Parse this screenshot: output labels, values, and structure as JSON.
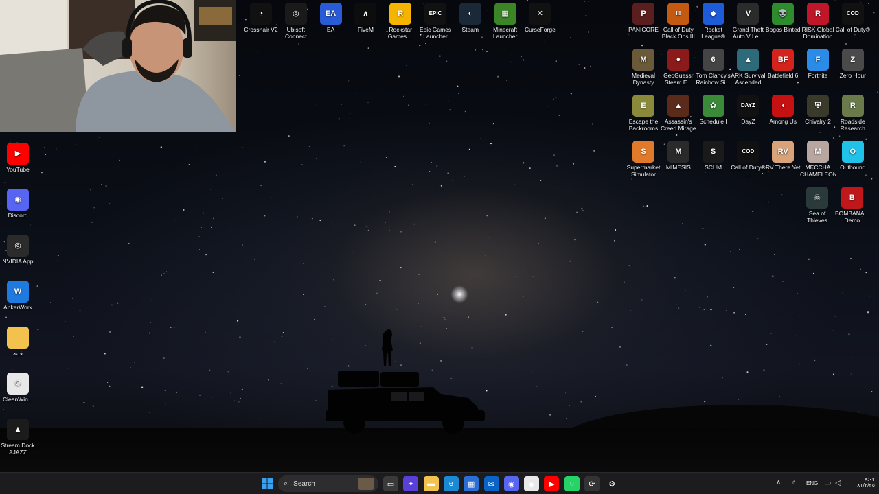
{
  "colors": {
    "accent": "#0a74da",
    "taskbar_bg": "#1c1c1e",
    "sky_top": "#06080d",
    "ground": "#050506"
  },
  "wallpaper": {
    "scene": "night-sky-milky-way-person-on-jeep"
  },
  "webcam_overlay": {
    "subject": "streamer-with-headphones"
  },
  "left_icons": [
    {
      "label": "YouTube",
      "icon": "youtube-icon",
      "color": "#ff0000",
      "glyph": "▶"
    },
    {
      "label": "Discord",
      "icon": "discord-icon",
      "color": "#5865f2",
      "glyph": "◉"
    },
    {
      "label": "NVIDIA App",
      "icon": "nvidia-icon",
      "color": "#2b2b2b",
      "glyph": "◎"
    },
    {
      "label": "AnkerWork",
      "icon": "ankerwork-icon",
      "color": "#1f7ae0",
      "glyph": "W"
    },
    {
      "label": "فلته",
      "icon": "folder-icon",
      "color": "#f2c14e",
      "glyph": ""
    },
    {
      "label": "CleanWin...",
      "icon": "cleanwin-icon",
      "color": "#e8e8e8",
      "glyph": "⚙"
    },
    {
      "label": "Stream Dock AJAZZ",
      "icon": "stream-dock-icon",
      "color": "#1b1b1b",
      "glyph": "▲"
    }
  ],
  "top_icons": [
    {
      "label": "Crosshair V2",
      "icon": "crosshair-icon",
      "color": "#111",
      "glyph": "◔"
    },
    {
      "label": "Ubisoft Connect",
      "icon": "ubisoft-icon",
      "color": "#1a1a1a",
      "glyph": "◎"
    },
    {
      "label": "EA",
      "icon": "ea-icon",
      "color": "#2a5bd7",
      "glyph": "EA"
    },
    {
      "label": "FiveM",
      "icon": "fivem-icon",
      "color": "#0d0d0d",
      "glyph": "∧"
    },
    {
      "label": "Rockstar Games ...",
      "icon": "rockstar-icon",
      "color": "#f4b400",
      "glyph": "R"
    },
    {
      "label": "Epic Games Launcher",
      "icon": "epic-games-icon",
      "color": "#111",
      "glyph": "EPIC"
    },
    {
      "label": "Steam",
      "icon": "steam-icon",
      "color": "#1b2838",
      "glyph": "◐"
    },
    {
      "label": "Minecraft Launcher",
      "icon": "minecraft-icon",
      "color": "#3c8527",
      "glyph": "▦"
    },
    {
      "label": "CurseForge",
      "icon": "curseforge-icon",
      "color": "#111",
      "glyph": "✕"
    }
  ],
  "right_icons": [
    {
      "label": "PANICORE",
      "icon": "panicore-icon",
      "color": "#5a1e1e",
      "glyph": "P"
    },
    {
      "label": "Call of Duty Black Ops III",
      "icon": "cod-bo3-icon",
      "color": "#c45a12",
      "glyph": "III"
    },
    {
      "label": "Rocket League®",
      "icon": "rocket-league-icon",
      "color": "#1e5bd8",
      "glyph": "◆"
    },
    {
      "label": "Grand Theft Auto V Le...",
      "icon": "gta5-icon",
      "color": "#2b2b2b",
      "glyph": "V"
    },
    {
      "label": "Bogos Binted",
      "icon": "alien-icon",
      "color": "#2e8b2e",
      "glyph": "👽"
    },
    {
      "label": "RISK Global Domination",
      "icon": "risk-icon",
      "color": "#c0162a",
      "glyph": "R"
    },
    {
      "label": "Call of Duty®",
      "icon": "call-of-duty-icon",
      "color": "#111",
      "glyph": "COD"
    },
    {
      "label": "Medieval Dynasty",
      "icon": "medieval-dynasty-icon",
      "color": "#6b5a3a",
      "glyph": "M"
    },
    {
      "label": "GeoGuessr Steam E...",
      "icon": "geoguessr-icon",
      "color": "#8b1a1a",
      "glyph": "●"
    },
    {
      "label": "Tom Clancy's Rainbow Si...",
      "icon": "rainbow-six-icon",
      "color": "#444",
      "glyph": "6"
    },
    {
      "label": "ARK Survival Ascended",
      "icon": "ark-icon",
      "color": "#2d6b7a",
      "glyph": "▲"
    },
    {
      "label": "Battlefield 6",
      "icon": "battlefield-icon",
      "color": "#d4221c",
      "glyph": "BF"
    },
    {
      "label": "Fortnite",
      "icon": "fortnite-icon",
      "color": "#2a8ce8",
      "glyph": "F"
    },
    {
      "label": "Zero Hour",
      "icon": "zero-hour-icon",
      "color": "#4a4a4a",
      "glyph": "Z"
    },
    {
      "label": "Escape the Backrooms",
      "icon": "escape-backrooms-icon",
      "color": "#8a8a3a",
      "glyph": "E"
    },
    {
      "label": "Assassin's Creed Mirage",
      "icon": "assassins-creed-icon",
      "color": "#5a2a1a",
      "glyph": "▲"
    },
    {
      "label": "Schedule I",
      "icon": "schedule-one-icon",
      "color": "#3a8a3a",
      "glyph": "✿"
    },
    {
      "label": "DayZ",
      "icon": "dayz-icon",
      "color": "#111",
      "glyph": "DAYZ"
    },
    {
      "label": "Among Us",
      "icon": "among-us-icon",
      "color": "#c51111",
      "glyph": "◖"
    },
    {
      "label": "Chivalry 2",
      "icon": "chivalry-icon",
      "color": "#3a3a2a",
      "glyph": "⛨"
    },
    {
      "label": "Roadside Research",
      "icon": "roadside-research-icon",
      "color": "#6a7a4a",
      "glyph": "R"
    },
    {
      "label": "Supermarket Simulator",
      "icon": "supermarket-icon",
      "color": "#e07a2a",
      "glyph": "S"
    },
    {
      "label": "MIMESIS",
      "icon": "mimesis-icon",
      "color": "#2a2a2a",
      "glyph": "M"
    },
    {
      "label": "SCUM",
      "icon": "scum-icon",
      "color": "#1a1a1a",
      "glyph": "S"
    },
    {
      "label": "Call of Duty® ...",
      "icon": "call-of-duty-icon",
      "color": "#111",
      "glyph": "COD"
    },
    {
      "label": "RV There Yet",
      "icon": "rv-there-yet-icon",
      "color": "#d9a37a",
      "glyph": "RV"
    },
    {
      "label": "MECCHA CHAMELEON",
      "icon": "chameleon-icon",
      "color": "#b8a6a0",
      "glyph": "M"
    },
    {
      "label": "Outbound",
      "icon": "outbound-icon",
      "color": "#21c2e8",
      "glyph": "O"
    },
    {
      "label": "Sea of Thieves",
      "icon": "sea-of-thieves-icon",
      "color": "#2a3a3a",
      "glyph": "☠"
    },
    {
      "label": "BOMBANA... Demo",
      "icon": "bombana-icon",
      "color": "#c0181a",
      "glyph": "B"
    }
  ],
  "taskbar": {
    "search_placeholder": "Search",
    "language": "ENG",
    "time": "٨:٠٢",
    "date": "٨١/٢/٢٥",
    "pinned": [
      {
        "name": "task-view-icon",
        "color": "#3a3a3a",
        "glyph": "▭"
      },
      {
        "name": "copilot-icon",
        "color": "#5a3fd9",
        "glyph": "✦"
      },
      {
        "name": "file-explorer-icon",
        "color": "#f2c14e",
        "glyph": "▬"
      },
      {
        "name": "edge-icon",
        "color": "#1a8ad4",
        "glyph": "e"
      },
      {
        "name": "microsoft-store-icon",
        "color": "#2a6fd6",
        "glyph": "▦"
      },
      {
        "name": "outlook-icon",
        "color": "#0a64c8",
        "glyph": "✉"
      },
      {
        "name": "discord-taskbar-icon",
        "color": "#5865f2",
        "glyph": "◉"
      },
      {
        "name": "chrome-icon",
        "color": "#e8e8e8",
        "glyph": "◉"
      },
      {
        "name": "youtube-taskbar-icon",
        "color": "#ff0000",
        "glyph": "▶"
      },
      {
        "name": "whatsapp-icon",
        "color": "#25d366",
        "glyph": "◌"
      },
      {
        "name": "steelseries-icon",
        "color": "#333",
        "glyph": "⟳"
      },
      {
        "name": "settings-icon",
        "color": "#1c1c1e",
        "glyph": "⚙"
      }
    ]
  }
}
